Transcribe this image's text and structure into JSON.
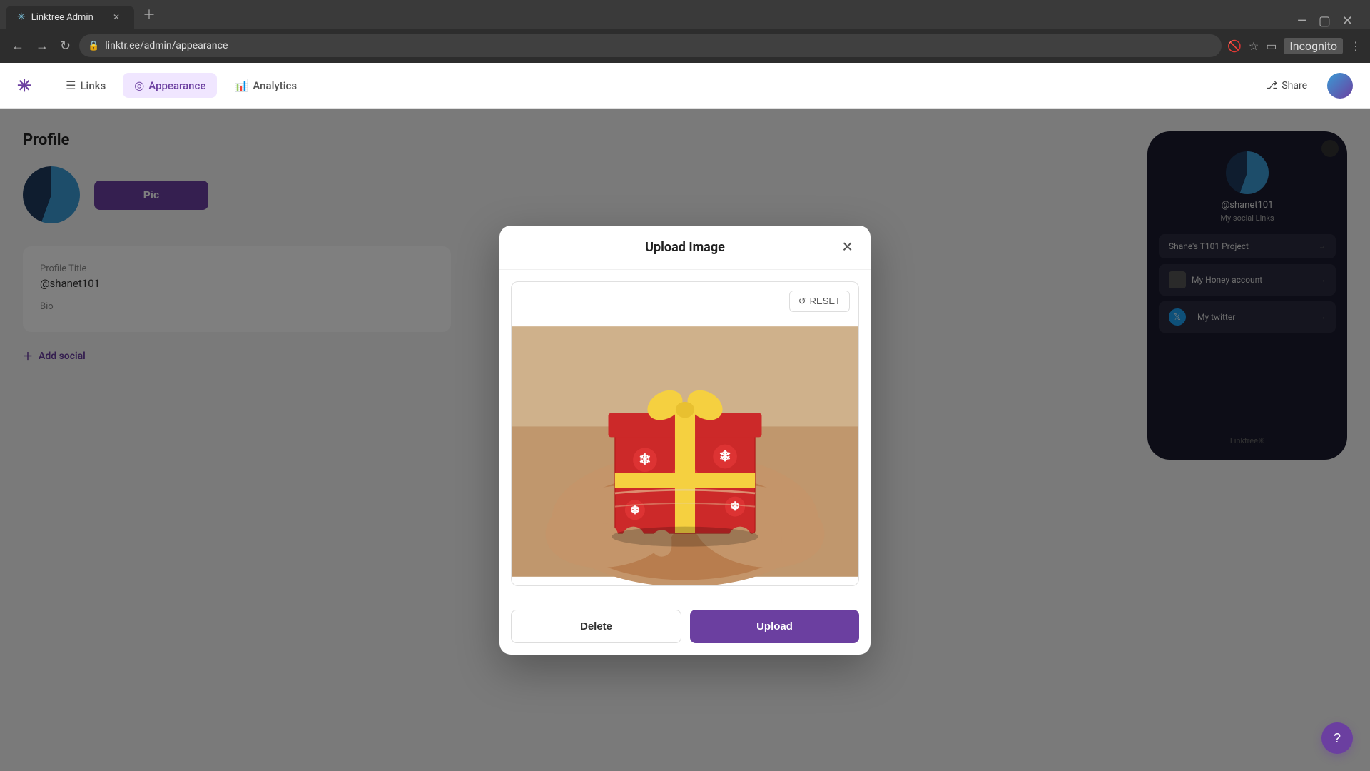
{
  "browser": {
    "tab_title": "Linktree Admin",
    "tab_favicon": "✳",
    "url": "linktr.ee/admin/appearance",
    "incognito_label": "Incognito"
  },
  "nav": {
    "logo_icon": "✳",
    "links_label": "Links",
    "appearance_label": "Appearance",
    "analytics_label": "Analytics",
    "share_label": "Share"
  },
  "profile": {
    "section_title": "Profile",
    "pick_image_label": "Pic",
    "profile_title_label": "Profile Title",
    "profile_title_value": "@shanet101",
    "bio_label": "Bio",
    "bio_placeholder": "",
    "add_social_label": "Add social"
  },
  "phone_preview": {
    "username": "@shanet101",
    "social_links_label": "My social Links",
    "link1_label": "Shane's T101 Project",
    "link2_label": "My Honey account",
    "link3_label": "My twitter",
    "footer_label": "Linktree✳"
  },
  "modal": {
    "title": "Upload Image",
    "reset_label": "RESET",
    "delete_label": "Delete",
    "upload_label": "Upload"
  },
  "help": {
    "label": "?"
  }
}
